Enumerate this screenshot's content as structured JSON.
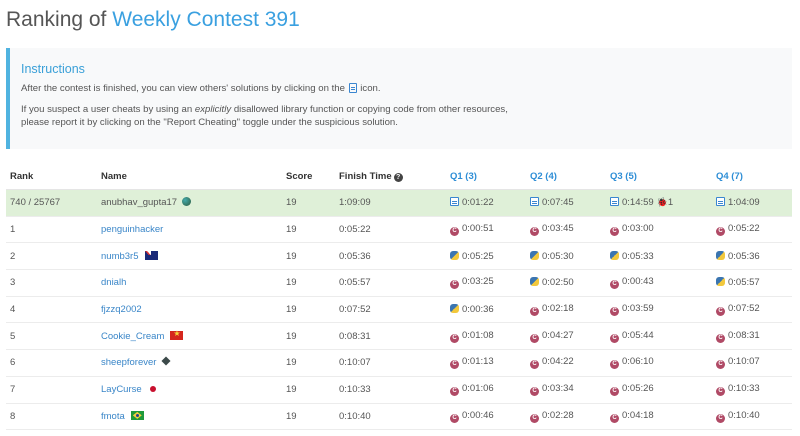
{
  "page": {
    "title_prefix": "Ranking of",
    "contest_name": "Weekly Contest 391"
  },
  "instructions": {
    "heading": "Instructions",
    "line1_before": "After the contest is finished, you can view others' solutions by clicking on the",
    "line1_after": "icon.",
    "line2_before": "If you suspect a user cheats by using an",
    "line2_em": "explicitly",
    "line2_after": "disallowed library function or copying code from other resources,",
    "line3": "please report it by clicking on the \"Report Cheating\" toggle under the suspicious solution."
  },
  "table": {
    "headers": {
      "rank": "Rank",
      "name": "Name",
      "score": "Score",
      "finish_time": "Finish Time",
      "q1": "Q1 (3)",
      "q2": "Q2 (4)",
      "q3": "Q3 (5)",
      "q4": "Q4 (7)"
    },
    "rows": [
      {
        "rank": "740 / 25767",
        "name": "anubhav_gupta17",
        "badge": "globe",
        "score": "19",
        "finish": "1:09:09",
        "q": [
          {
            "lang": "doc",
            "time": "0:01:22"
          },
          {
            "lang": "doc",
            "time": "0:07:45"
          },
          {
            "lang": "doc",
            "time": "0:14:59",
            "bug": "1"
          },
          {
            "lang": "doc",
            "time": "1:04:09"
          }
        ]
      },
      {
        "rank": "1",
        "name": "penguinhacker",
        "badge": "",
        "score": "19",
        "finish": "0:05:22",
        "q": [
          {
            "lang": "cpp",
            "time": "0:00:51"
          },
          {
            "lang": "cpp",
            "time": "0:03:45"
          },
          {
            "lang": "cpp",
            "time": "0:03:00"
          },
          {
            "lang": "cpp",
            "time": "0:05:22"
          }
        ]
      },
      {
        "rank": "2",
        "name": "numb3r5",
        "badge": "flag-au",
        "score": "19",
        "finish": "0:05:36",
        "q": [
          {
            "lang": "py",
            "time": "0:05:25"
          },
          {
            "lang": "py",
            "time": "0:05:30"
          },
          {
            "lang": "py",
            "time": "0:05:33"
          },
          {
            "lang": "py",
            "time": "0:05:36"
          }
        ]
      },
      {
        "rank": "3",
        "name": "dnialh",
        "badge": "",
        "score": "19",
        "finish": "0:05:57",
        "q": [
          {
            "lang": "cpp",
            "time": "0:03:25"
          },
          {
            "lang": "py",
            "time": "0:02:50"
          },
          {
            "lang": "cpp",
            "time": "0:00:43"
          },
          {
            "lang": "py",
            "time": "0:05:57"
          }
        ]
      },
      {
        "rank": "4",
        "name": "fjzzq2002",
        "badge": "",
        "score": "19",
        "finish": "0:07:52",
        "q": [
          {
            "lang": "py",
            "time": "0:00:36"
          },
          {
            "lang": "cpp",
            "time": "0:02:18"
          },
          {
            "lang": "cpp",
            "time": "0:03:59"
          },
          {
            "lang": "cpp",
            "time": "0:07:52"
          }
        ]
      },
      {
        "rank": "5",
        "name": "Cookie_Cream",
        "badge": "flag-vn",
        "score": "19",
        "finish": "0:08:31",
        "q": [
          {
            "lang": "cpp",
            "time": "0:01:08"
          },
          {
            "lang": "cpp",
            "time": "0:04:27"
          },
          {
            "lang": "cpp",
            "time": "0:05:44"
          },
          {
            "lang": "cpp",
            "time": "0:08:31"
          }
        ]
      },
      {
        "rank": "6",
        "name": "sheepforever",
        "badge": "cube",
        "score": "19",
        "finish": "0:10:07",
        "q": [
          {
            "lang": "cpp",
            "time": "0:01:13"
          },
          {
            "lang": "cpp",
            "time": "0:04:22"
          },
          {
            "lang": "cpp",
            "time": "0:06:10"
          },
          {
            "lang": "cpp",
            "time": "0:10:07"
          }
        ]
      },
      {
        "rank": "7",
        "name": "LayCurse",
        "badge": "flag-jp",
        "score": "19",
        "finish": "0:10:33",
        "q": [
          {
            "lang": "cpp",
            "time": "0:01:06"
          },
          {
            "lang": "cpp",
            "time": "0:03:34"
          },
          {
            "lang": "cpp",
            "time": "0:05:26"
          },
          {
            "lang": "cpp",
            "time": "0:10:33"
          }
        ]
      },
      {
        "rank": "8",
        "name": "fmota",
        "badge": "flag-br",
        "score": "19",
        "finish": "0:10:40",
        "q": [
          {
            "lang": "cpp",
            "time": "0:00:46"
          },
          {
            "lang": "cpp",
            "time": "0:02:28"
          },
          {
            "lang": "cpp",
            "time": "0:04:18"
          },
          {
            "lang": "cpp",
            "time": "0:10:40"
          }
        ]
      }
    ]
  }
}
